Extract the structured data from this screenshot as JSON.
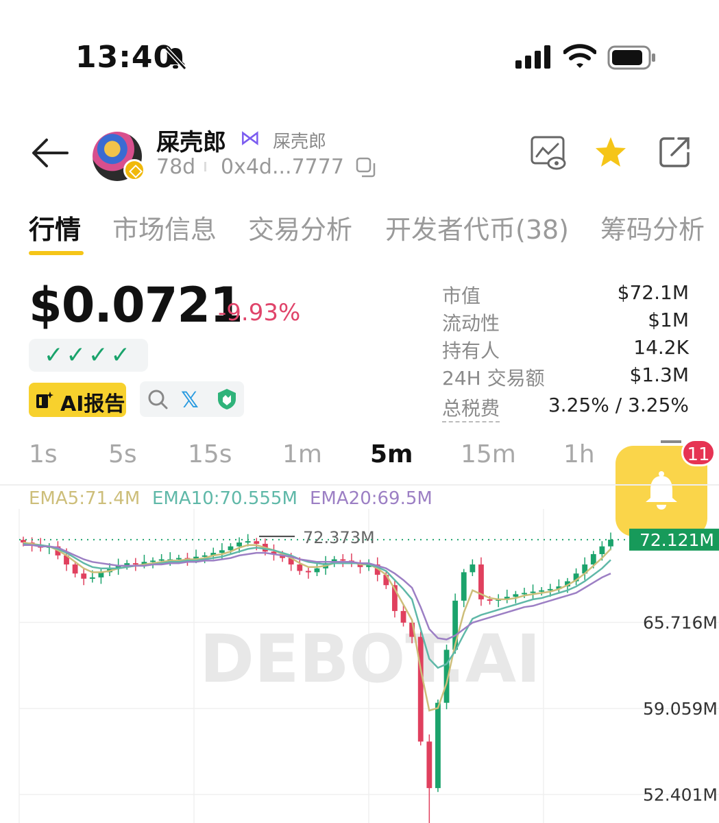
{
  "status_bar": {
    "time": "13:40",
    "icons": [
      "bell-slash-icon",
      "signal-icon",
      "wifi-icon",
      "battery-icon"
    ]
  },
  "header": {
    "token_name": "屎壳郎",
    "token_alias": "屎壳郎",
    "age": "78d",
    "address": "0x4d...7777",
    "icons": [
      "back-arrow-icon",
      "chain-bnb-icon",
      "butterfly-icon",
      "copy-icon",
      "watch-chart-icon",
      "star-icon",
      "share-icon"
    ]
  },
  "tabs": [
    {
      "label": "行情",
      "active": true
    },
    {
      "label": "市场信息",
      "active": false
    },
    {
      "label": "交易分析",
      "active": false
    },
    {
      "label": "开发者代币(38)",
      "active": false
    },
    {
      "label": "筹码分析",
      "active": false
    }
  ],
  "price": {
    "value": "$0.0721",
    "change": "-9.93%",
    "checks": "✓✓✓✓"
  },
  "actions": {
    "ai_report": "AI报告",
    "icons": [
      "search-icon",
      "x-icon",
      "shield-icon"
    ]
  },
  "stats": [
    {
      "label": "市值",
      "value": "$72.1M"
    },
    {
      "label": "流动性",
      "value": "$1M"
    },
    {
      "label": "持有人",
      "value": "14.2K"
    },
    {
      "label": "24H 交易额",
      "value": "$1.3M"
    },
    {
      "label": "总税费",
      "value": "3.25% / 3.25%"
    }
  ],
  "intervals": [
    {
      "label": "1s",
      "active": false
    },
    {
      "label": "5s",
      "active": false
    },
    {
      "label": "15s",
      "active": false
    },
    {
      "label": "1m",
      "active": false
    },
    {
      "label": "5m",
      "active": true
    },
    {
      "label": "15m",
      "active": false
    },
    {
      "label": "1h",
      "active": false
    }
  ],
  "alert": {
    "badge": "11",
    "icon": "bell-icon"
  },
  "colors": {
    "up": "#1ba36c",
    "down": "#e0405e",
    "accent": "#f5c518",
    "ema5": "#cdbe7a",
    "ema10": "#5fb8a8",
    "ema20": "#9c7fc4"
  },
  "chart_data": {
    "type": "candlestick",
    "indicators": [
      {
        "name": "EMA5",
        "label": "EMA5:71.4M"
      },
      {
        "name": "EMA10",
        "label": "EMA10:70.555M"
      },
      {
        "name": "EMA20",
        "label": "EMA20:69.5M"
      }
    ],
    "watermark": "DEBOT.AI",
    "y_ticks": [
      "65.716M",
      "59.059M",
      "52.401M"
    ],
    "y_tick_values": [
      65.716,
      59.059,
      52.401
    ],
    "current_price_label": "72.121M",
    "current_price": 72.121,
    "high_label": "72.373M",
    "high_value": 72.373,
    "ylim": [
      50.2,
      74.5
    ],
    "close": [
      71.9,
      71.7,
      71.5,
      71.6,
      70.9,
      70.2,
      69.5,
      69.1,
      69.2,
      69.6,
      69.9,
      70.1,
      70.3,
      70.2,
      70.4,
      70.5,
      70.6,
      70.6,
      70.7,
      70.6,
      70.8,
      70.9,
      71.1,
      71.3,
      71.6,
      71.9,
      72.0,
      71.8,
      71.2,
      71.0,
      70.7,
      70.2,
      69.7,
      69.6,
      69.9,
      70.3,
      70.6,
      70.5,
      70.3,
      70.0,
      70.2,
      69.4,
      68.6,
      66.6,
      65.7,
      64.6,
      56.5,
      52.9,
      59.5,
      63.6,
      67.4,
      69.6,
      70.2,
      67.5,
      67.4,
      67.5,
      67.7,
      67.9,
      68.0,
      68.1,
      68.2,
      68.3,
      68.5,
      68.9,
      69.5,
      70.2,
      71.0,
      71.6,
      72.12
    ],
    "open": [
      72.1,
      71.9,
      71.7,
      71.5,
      71.6,
      70.9,
      70.2,
      69.5,
      69.1,
      69.2,
      69.6,
      69.9,
      70.1,
      70.3,
      70.2,
      70.4,
      70.5,
      70.6,
      70.6,
      70.7,
      70.6,
      70.8,
      70.9,
      71.1,
      71.3,
      71.6,
      71.9,
      72.0,
      71.8,
      71.2,
      71.0,
      70.7,
      70.2,
      69.7,
      69.6,
      69.9,
      70.3,
      70.6,
      70.5,
      70.3,
      70.0,
      70.2,
      69.4,
      68.6,
      66.6,
      65.7,
      64.6,
      56.5,
      52.9,
      59.5,
      63.6,
      67.4,
      69.6,
      70.2,
      67.5,
      67.4,
      67.5,
      67.7,
      67.9,
      68.0,
      68.1,
      68.2,
      68.3,
      68.5,
      68.9,
      69.5,
      70.2,
      71.0,
      71.6
    ],
    "ema5": [
      71.9,
      71.8,
      71.7,
      71.6,
      71.3,
      70.9,
      70.4,
      69.9,
      69.6,
      69.6,
      69.7,
      69.9,
      70.0,
      70.1,
      70.2,
      70.3,
      70.4,
      70.5,
      70.5,
      70.6,
      70.6,
      70.7,
      70.9,
      71.0,
      71.2,
      71.5,
      71.7,
      71.7,
      71.5,
      71.3,
      71.0,
      70.7,
      70.3,
      70.0,
      70.0,
      70.1,
      70.3,
      70.4,
      70.4,
      70.2,
      70.2,
      69.9,
      69.4,
      68.3,
      67.1,
      65.9,
      62.1,
      58.9,
      59.1,
      61.0,
      64.0,
      66.5,
      68.2,
      67.9,
      67.6,
      67.5,
      67.5,
      67.6,
      67.8,
      67.9,
      68.0,
      68.1,
      68.3,
      68.6,
      69.0,
      69.5,
      70.1,
      70.7,
      71.4
    ],
    "ema10": [
      71.8,
      71.7,
      71.7,
      71.6,
      71.4,
      71.1,
      70.7,
      70.3,
      70.0,
      69.9,
      69.9,
      69.9,
      70.0,
      70.1,
      70.1,
      70.2,
      70.3,
      70.4,
      70.4,
      70.5,
      70.5,
      70.6,
      70.7,
      70.8,
      71.0,
      71.2,
      71.4,
      71.5,
      71.4,
      71.3,
      71.1,
      70.9,
      70.6,
      70.4,
      70.3,
      70.2,
      70.3,
      70.3,
      70.3,
      70.3,
      70.2,
      70.0,
      69.7,
      69.0,
      68.3,
      67.5,
      65.2,
      62.9,
      62.2,
      62.5,
      63.5,
      64.8,
      66.0,
      66.3,
      66.5,
      66.7,
      66.9,
      67.1,
      67.3,
      67.5,
      67.6,
      67.8,
      68.0,
      68.2,
      68.5,
      68.9,
      69.4,
      69.9,
      70.555
    ],
    "ema20": [
      71.7,
      71.7,
      71.6,
      71.6,
      71.5,
      71.2,
      70.9,
      70.6,
      70.4,
      70.3,
      70.2,
      70.1,
      70.1,
      70.1,
      70.1,
      70.2,
      70.2,
      70.3,
      70.3,
      70.4,
      70.4,
      70.5,
      70.5,
      70.6,
      70.7,
      70.9,
      71.0,
      71.1,
      71.1,
      71.0,
      70.9,
      70.8,
      70.6,
      70.5,
      70.4,
      70.4,
      70.4,
      70.4,
      70.4,
      70.3,
      70.3,
      70.1,
      69.9,
      69.5,
      69.0,
      68.4,
      66.9,
      65.2,
      64.5,
      64.4,
      64.7,
      65.2,
      65.7,
      65.9,
      66.1,
      66.3,
      66.5,
      66.7,
      66.9,
      67.0,
      67.2,
      67.4,
      67.6,
      67.8,
      68.0,
      68.4,
      68.8,
      69.2,
      69.5
    ]
  }
}
